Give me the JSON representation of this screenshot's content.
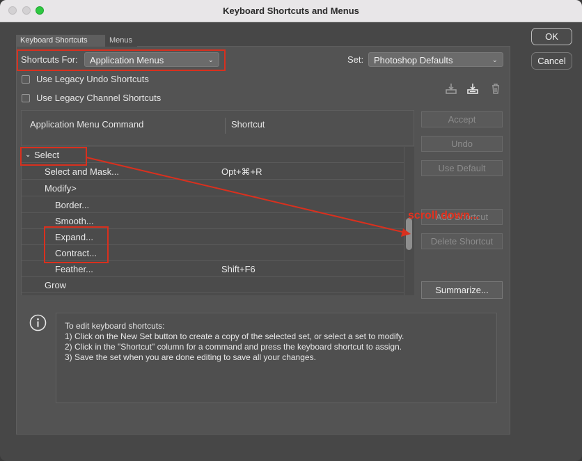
{
  "window": {
    "title": "Keyboard Shortcuts and Menus"
  },
  "tabs": [
    {
      "label": "Keyboard Shortcuts"
    },
    {
      "label": "Menus"
    }
  ],
  "shortcuts_for": {
    "label": "Shortcuts For:",
    "value": "Application Menus"
  },
  "set": {
    "label": "Set:",
    "value": "Photoshop Defaults"
  },
  "checkboxes": [
    {
      "label": "Use Legacy Undo Shortcuts",
      "checked": false
    },
    {
      "label": "Use Legacy Channel Shortcuts",
      "checked": false
    }
  ],
  "dialog_buttons": {
    "ok": "OK",
    "cancel": "Cancel"
  },
  "table": {
    "col_command": "Application Menu Command",
    "col_shortcut": "Shortcut",
    "rows": [
      {
        "command": "Select",
        "shortcut": ""
      },
      {
        "command": "Select and Mask...",
        "shortcut": "Opt+⌘+R"
      },
      {
        "command": "Modify>",
        "shortcut": ""
      },
      {
        "command": "Border...",
        "shortcut": ""
      },
      {
        "command": "Smooth...",
        "shortcut": ""
      },
      {
        "command": "Expand...",
        "shortcut": ""
      },
      {
        "command": "Contract...",
        "shortcut": ""
      },
      {
        "command": "Feather...",
        "shortcut": "Shift+F6"
      },
      {
        "command": "Grow",
        "shortcut": ""
      }
    ]
  },
  "side_buttons": {
    "accept": "Accept",
    "undo": "Undo",
    "use_default": "Use Default",
    "add_shortcut": "Add Shortcut",
    "delete_shortcut": "Delete Shortcut",
    "summarize": "Summarize..."
  },
  "info": {
    "lines": [
      "To edit keyboard shortcuts:",
      "1) Click on the New Set button to create a copy of the selected set, or select a set to modify.",
      "2) Click in the \"Shortcut\" column for a command and press the keyboard shortcut to assign.",
      "3) Save the set when you are done editing to save all your changes."
    ]
  },
  "annotation": {
    "text": "scroll down..."
  },
  "colors": {
    "annotation": "#e2321f",
    "dialog_bg": "#474747"
  }
}
